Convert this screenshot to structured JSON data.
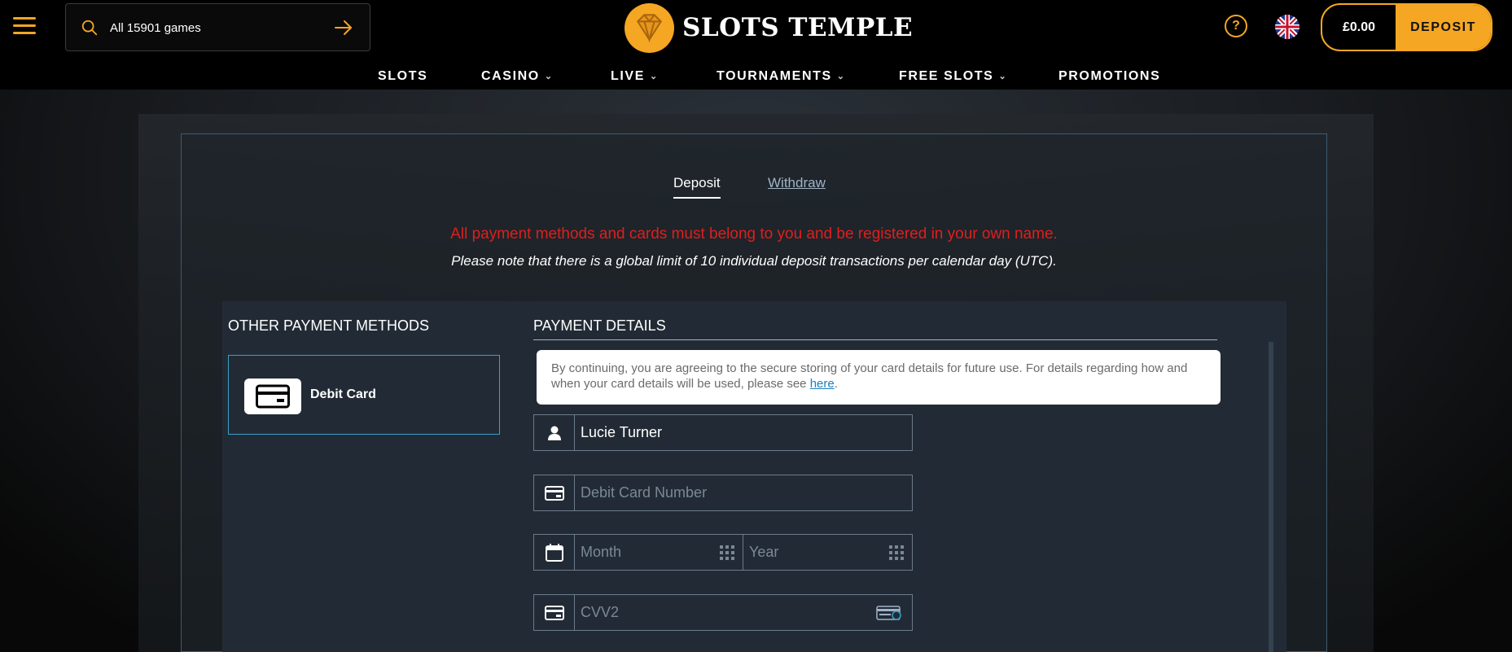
{
  "header": {
    "search": {
      "value": "All 15901 games",
      "placeholder": "All 15901 games"
    },
    "logo_text": "SLOTS TEMPLE",
    "help_label": "?",
    "balance": "£0.00",
    "deposit_label": "DEPOSIT"
  },
  "nav": {
    "items": [
      {
        "label": "SLOTS"
      },
      {
        "label": "CASINO"
      },
      {
        "label": "LIVE"
      },
      {
        "label": "TOURNAMENTS"
      },
      {
        "label": "FREE SLOTS"
      },
      {
        "label": "PROMOTIONS"
      }
    ]
  },
  "tabs": {
    "deposit": "Deposit",
    "withdraw": "Withdraw"
  },
  "messages": {
    "warning": "All payment methods and cards must belong to you and be registered in your own name.",
    "note": "Please note that there is a global limit of 10 individual deposit transactions per calendar day (UTC)."
  },
  "methods": {
    "title": "OTHER PAYMENT METHODS",
    "items": [
      {
        "label": "Debit Card"
      }
    ]
  },
  "payment": {
    "title": "PAYMENT DETAILS",
    "consent_text": "By continuing, you are agreeing to the secure storing of your card details for future use. For details regarding how and when your card details will be used, please see ",
    "consent_link": "here",
    "consent_end": ".",
    "name_value": "Lucie Turner",
    "card_placeholder": "Debit Card Number",
    "month_placeholder": "Month",
    "year_placeholder": "Year",
    "cvv_placeholder": "CVV2"
  },
  "colors": {
    "accent": "#f5a623",
    "warning": "#e01e1e",
    "panel": "#222b35",
    "link": "#1a7fc1"
  }
}
